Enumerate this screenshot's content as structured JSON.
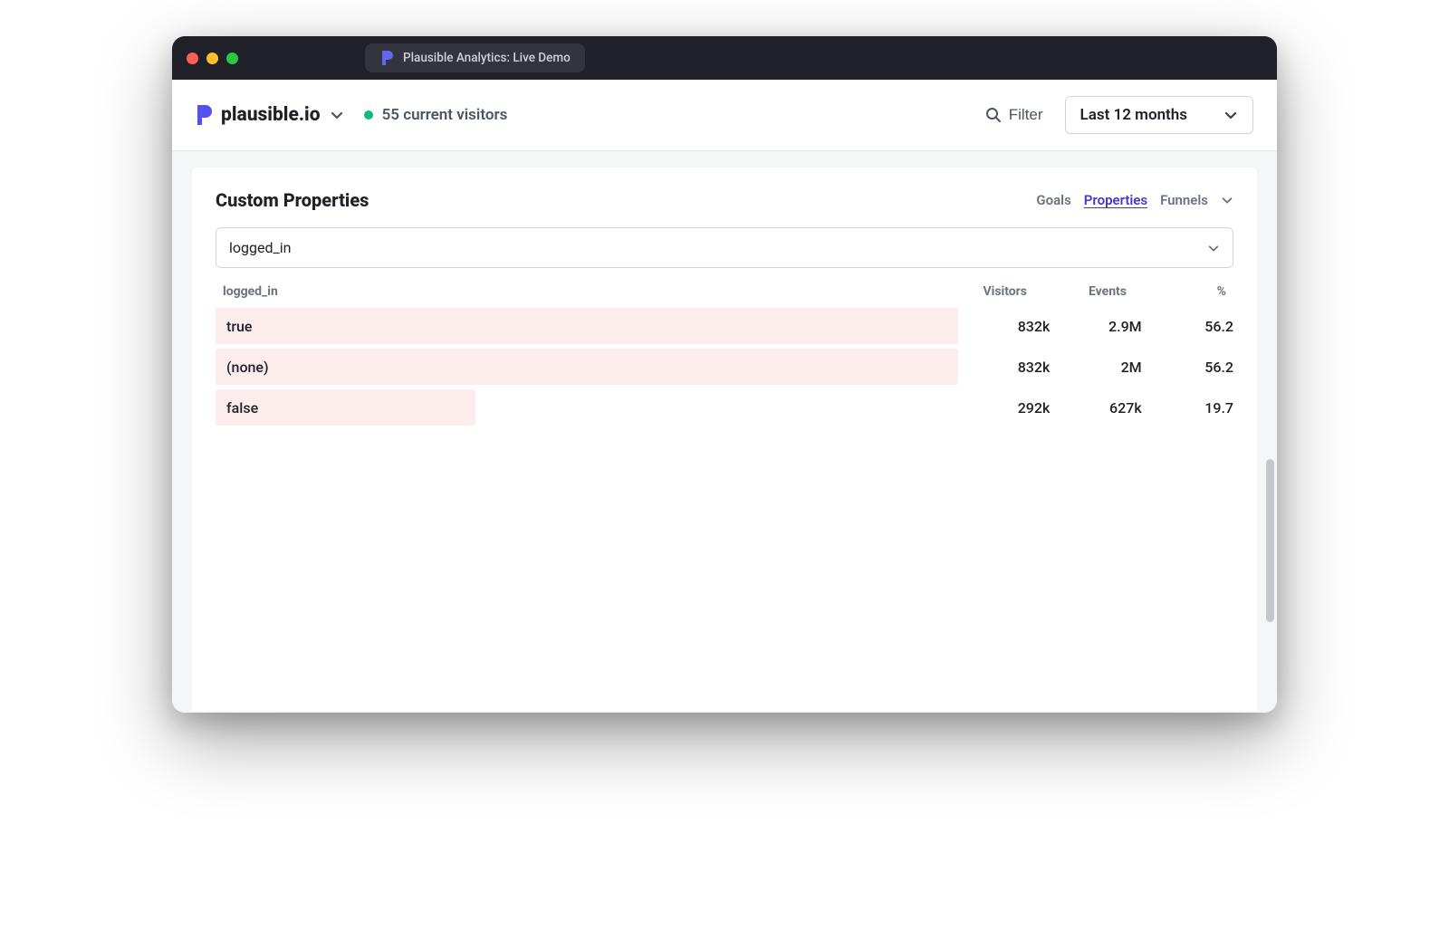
{
  "window": {
    "tab_title": "Plausible Analytics: Live Demo"
  },
  "header": {
    "site_name": "plausible.io",
    "live_visitors_text": "55 current visitors",
    "filter_label": "Filter",
    "period_label": "Last 12 months"
  },
  "card": {
    "title": "Custom Properties",
    "tabs": {
      "goals": "Goals",
      "properties": "Properties",
      "funnels": "Funnels"
    },
    "property_select_value": "logged_in",
    "columns": {
      "label": "logged_in",
      "visitors": "Visitors",
      "events": "Events",
      "percent": "%"
    },
    "rows": [
      {
        "label": "true",
        "visitors": "832k",
        "events": "2.9M",
        "percent": "56.2",
        "bar_pct": 100
      },
      {
        "label": "(none)",
        "visitors": "832k",
        "events": "2M",
        "percent": "56.2",
        "bar_pct": 100
      },
      {
        "label": "false",
        "visitors": "292k",
        "events": "627k",
        "percent": "19.7",
        "bar_pct": 35
      }
    ]
  },
  "chart_data": {
    "type": "bar",
    "title": "Custom Properties — logged_in",
    "categories": [
      "true",
      "(none)",
      "false"
    ],
    "series": [
      {
        "name": "Visitors",
        "values": [
          832000,
          832000,
          292000
        ]
      },
      {
        "name": "Events",
        "values": [
          2900000,
          2000000,
          627000
        ]
      },
      {
        "name": "Percent",
        "values": [
          56.2,
          56.2,
          19.7
        ]
      }
    ],
    "xlabel": "logged_in",
    "ylabel": "",
    "ylim": [
      0,
      3000000
    ]
  }
}
